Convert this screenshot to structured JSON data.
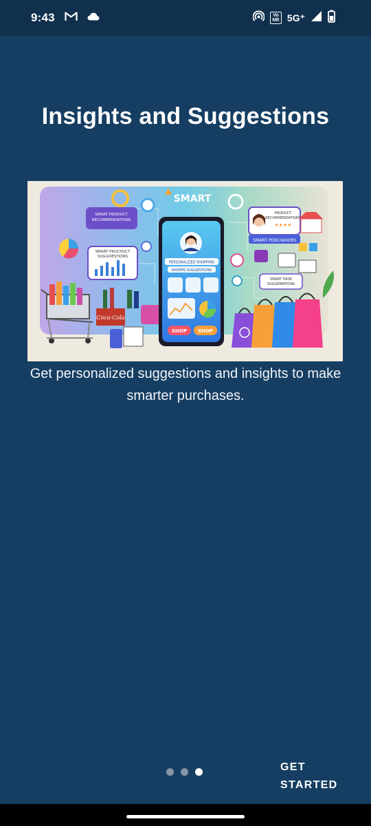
{
  "status_bar": {
    "time": "9:43",
    "network": "5G⁺",
    "volte_badge_top": "Vo",
    "volte_badge_bottom": "NR",
    "icons": [
      "gmail-icon",
      "cloud-icon",
      "hotspot-icon",
      "signal-icon",
      "battery-icon"
    ]
  },
  "onboarding": {
    "title": "Insights and Suggestions",
    "description": "Get personalized suggestions and insights to make smarter purchases.",
    "hero_labels": {
      "smart": "SMART",
      "product_recs_left": "SMART PRODUCT RECOMMENDATIONS",
      "product_suggestions": "SMART PRUCHUCT SUGGOESTIONS",
      "product_recs_right": "PRODUCT RECOMMENDATIONS",
      "smart_purchases": "SMART PERCHASORS",
      "purchase_suggestions": "SMART HASE SUGGEMATIONS",
      "personalized_shopping": "PERSONALIZED SHOPPING",
      "shopping_suggestions": "SHOPPO SUGGESTIONS",
      "shop_left": "SHOP",
      "shop_right": "SHOP",
      "cola": "Coca-Cola"
    },
    "pager": {
      "total": 3,
      "active_index": 2
    },
    "get_started_label": "GET STARTED"
  },
  "colors": {
    "background": "#163e62",
    "status_bar": "#11304d",
    "dot_inactive": "#8796a6",
    "dot_active": "#ffffff"
  }
}
